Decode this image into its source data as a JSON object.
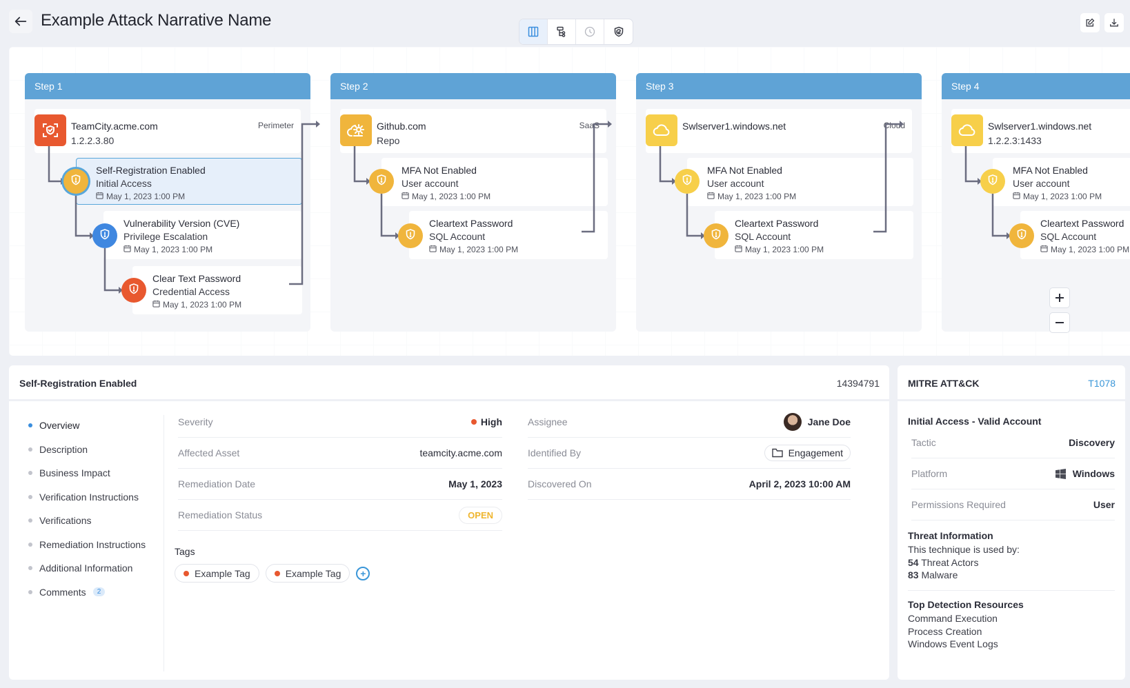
{
  "header": {
    "title": "Example Attack Narrative Name",
    "view_modes": [
      {
        "name": "columns-view",
        "icon": "columns-icon",
        "active": true
      },
      {
        "name": "tree-view",
        "icon": "tree-icon",
        "active": false
      },
      {
        "name": "timeline-view",
        "icon": "clock-icon",
        "active": false
      },
      {
        "name": "mitre-view",
        "icon": "shield-check-icon",
        "active": false
      }
    ],
    "actions": [
      {
        "name": "edit-button",
        "icon": "edit-icon"
      },
      {
        "name": "download-button",
        "icon": "download-icon"
      }
    ]
  },
  "colors": {
    "step_header": "#5fa3d6",
    "critical": "#e8582f",
    "warning": "#f0b53c",
    "warning_light": "#f7cf4a",
    "info": "#3f87e0",
    "link": "#3a96d8",
    "status_open": "#efb52e"
  },
  "steps": [
    {
      "label": "Step 1",
      "asset": {
        "name": "TeamCity.acme.com",
        "sub": "1.2.2.3.80",
        "zone": "Perimeter",
        "icon": "face-scan-shield-icon",
        "color": "#e8582f"
      },
      "findings": [
        {
          "title": "Self-Registration Enabled",
          "sub": "Initial Access",
          "date": "May 1, 2023 1:00 PM",
          "color": "#f0b53c",
          "selected": true
        },
        {
          "title": "Vulnerability Version (CVE)",
          "sub": "Privilege Escalation",
          "date": "May 1, 2023 1:00 PM",
          "color": "#3f87e0",
          "selected": false
        },
        {
          "title": "Clear Text Password",
          "sub": "Credential Access",
          "date": "May 1, 2023 1:00 PM",
          "color": "#e8582f",
          "selected": false
        }
      ]
    },
    {
      "label": "Step 2",
      "asset": {
        "name": "Github.com",
        "sub": "Repo",
        "zone": "SaaS",
        "icon": "cloud-gear-icon",
        "color": "#f0b53c"
      },
      "findings": [
        {
          "title": "MFA Not Enabled",
          "sub": "User account",
          "date": "May 1, 2023 1:00 PM",
          "color": "#f0b53c",
          "selected": false
        },
        {
          "title": "Cleartext Password",
          "sub": "SQL Account",
          "date": "May 1, 2023 1:00 PM",
          "color": "#f0b53c",
          "selected": false
        }
      ]
    },
    {
      "label": "Step 3",
      "asset": {
        "name": "Swlserver1.windows.net",
        "sub": "",
        "zone": "Cloud",
        "icon": "cloud-icon",
        "color": "#f7cf4a"
      },
      "findings": [
        {
          "title": "MFA Not Enabled",
          "sub": "User account",
          "date": "May 1, 2023 1:00 PM",
          "color": "#f7cf4a",
          "selected": false
        },
        {
          "title": "Cleartext Password",
          "sub": "SQL Account",
          "date": "May 1, 2023 1:00 PM",
          "color": "#f0b53c",
          "selected": false
        }
      ]
    },
    {
      "label": "Step 4",
      "asset": {
        "name": "Swlserver1.windows.net",
        "sub": "1.2.2.3:1433",
        "zone": "",
        "icon": "cloud-icon",
        "color": "#f7cf4a"
      },
      "findings": [
        {
          "title": "MFA Not Enabled",
          "sub": "User account",
          "date": "May 1, 2023 1:00 PM",
          "color": "#f7cf4a",
          "selected": false
        },
        {
          "title": "Cleartext Password",
          "sub": "SQL Account",
          "date": "May 1, 2023 1:00 PM",
          "color": "#f0b53c",
          "selected": false
        }
      ]
    }
  ],
  "canvas_controls": {
    "zoom_in": "+",
    "zoom_out": "−"
  },
  "detail": {
    "title": "Self-Registration Enabled",
    "id": "14394791",
    "nav": [
      {
        "label": "Overview",
        "active": true
      },
      {
        "label": "Description"
      },
      {
        "label": "Business Impact"
      },
      {
        "label": "Verification Instructions"
      },
      {
        "label": "Verifications"
      },
      {
        "label": "Remediation Instructions"
      },
      {
        "label": "Additional Information"
      },
      {
        "label": "Comments",
        "count": "2"
      }
    ],
    "fields_left": [
      {
        "key": "Severity",
        "value": "High"
      },
      {
        "key": "Affected Asset",
        "value": "teamcity.acme.com"
      },
      {
        "key": "Remediation Date",
        "value": "May 1, 2023"
      },
      {
        "key": "Remediation Status",
        "value": "OPEN"
      }
    ],
    "fields_right": [
      {
        "key": "Assignee",
        "value": "Jane Doe"
      },
      {
        "key": "Identified By",
        "value": "Engagement"
      },
      {
        "key": "Discovered On",
        "value": "April 2, 2023 10:00 AM"
      }
    ],
    "tags_label": "Tags",
    "tags": [
      "Example Tag",
      "Example Tag"
    ],
    "add_tag": "+"
  },
  "mitre": {
    "title": "MITRE ATT&CK",
    "technique_id": "T1078",
    "technique": "Initial Access - Valid Account",
    "fields": [
      {
        "key": "Tactic",
        "value": "Discovery"
      },
      {
        "key": "Platform",
        "value": "Windows"
      },
      {
        "key": "Permissions Required",
        "value": "User"
      }
    ],
    "threat_title": "Threat Information",
    "threat_intro": "This technique is used by:",
    "threat_actors_count": "54",
    "threat_actors_label": "Threat Actors",
    "malware_count": "83",
    "malware_label": "Malware",
    "detection_title": "Top Detection Resources",
    "detection_resources": [
      "Command Execution",
      "Process Creation",
      "Windows Event Logs"
    ]
  }
}
